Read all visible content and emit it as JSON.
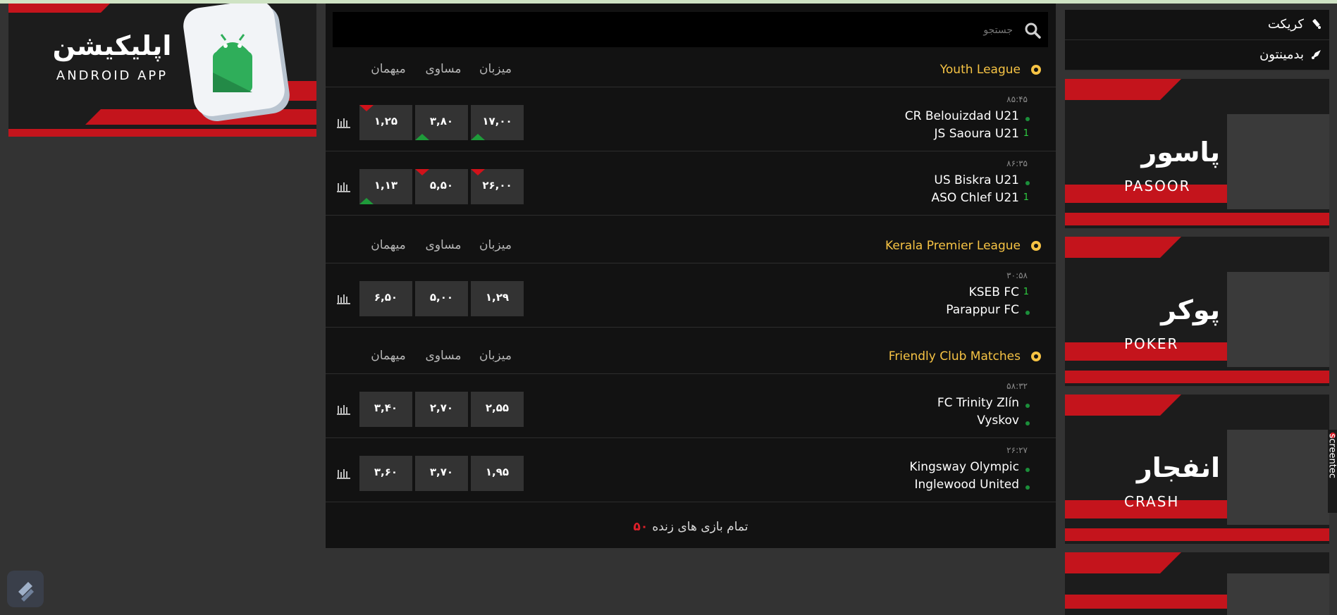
{
  "android_banner": {
    "title_fa": "اپلیکیشن",
    "title_en": "ANDROID APP"
  },
  "search": {
    "placeholder": "جستجو"
  },
  "columns": {
    "home": "میزبان",
    "draw": "مساوی",
    "away": "میهمان"
  },
  "leagues": [
    {
      "name": "Youth League",
      "matches": [
        {
          "time": "۸۵:۴۵",
          "team1": "CR Belouizdad U21",
          "team2": "JS Saoura U21",
          "team1_marker": "dot",
          "team2_marker": "1",
          "odds": {
            "home": "۱۷,۰۰",
            "draw": "۳,۸۰",
            "away": "۱,۲۵"
          },
          "trends": {
            "home": "up",
            "draw": "up",
            "away": "down"
          }
        },
        {
          "time": "۸۶:۳۵",
          "team1": "US Biskra U21",
          "team2": "ASO Chlef U21",
          "team1_marker": "dot",
          "team2_marker": "1",
          "odds": {
            "home": "۲۶,۰۰",
            "draw": "۵,۵۰",
            "away": "۱,۱۳"
          },
          "trends": {
            "home": "down",
            "draw": "down",
            "away": "up"
          }
        }
      ]
    },
    {
      "name": "Kerala Premier League",
      "matches": [
        {
          "time": "۳۰:۵۸",
          "team1": "KSEB FC",
          "team2": "Parappur FC",
          "team1_marker": "1",
          "team2_marker": "dot",
          "odds": {
            "home": "۱,۲۹",
            "draw": "۵,۰۰",
            "away": "۶,۵۰"
          },
          "trends": {
            "home": "",
            "draw": "",
            "away": ""
          }
        }
      ]
    },
    {
      "name": "Friendly Club Matches",
      "matches": [
        {
          "time": "۵۸:۳۲",
          "team1": "FC Trinity Zlín",
          "team2": "Vyskov",
          "team1_marker": "dot",
          "team2_marker": "dot",
          "odds": {
            "home": "۲,۵۵",
            "draw": "۲,۷۰",
            "away": "۳,۴۰"
          },
          "trends": {
            "home": "",
            "draw": "",
            "away": ""
          }
        },
        {
          "time": "۲۶:۲۷",
          "team1": "Kingsway Olympic",
          "team2": "Inglewood United",
          "team1_marker": "dot",
          "team2_marker": "dot",
          "odds": {
            "home": "۱,۹۵",
            "draw": "۳,۷۰",
            "away": "۳,۶۰"
          },
          "trends": {
            "home": "",
            "draw": "",
            "away": ""
          }
        }
      ]
    }
  ],
  "footer": {
    "label": "تمام بازی های زنده",
    "count": "۵۰"
  },
  "sidebar": {
    "sports": [
      {
        "label": "کریکت",
        "icon": "cricket-bat-icon"
      },
      {
        "label": "بدمینتون",
        "icon": "shuttlecock-icon"
      }
    ],
    "promos": [
      {
        "title_fa": "پاسور",
        "title_en": "PASOOR"
      },
      {
        "title_fa": "پوکر",
        "title_en": "POKER"
      },
      {
        "title_fa": "انفجار",
        "title_en": "CRASH"
      },
      {
        "title_fa": "",
        "title_en": ""
      }
    ]
  },
  "side_tab": {
    "label": "screentec"
  },
  "colors": {
    "accent_red": "#d1121a",
    "league_yellow": "#f6c344",
    "trend_up": "#1e9b3a",
    "panel_bg": "#121212",
    "odd_bg": "#333333"
  }
}
